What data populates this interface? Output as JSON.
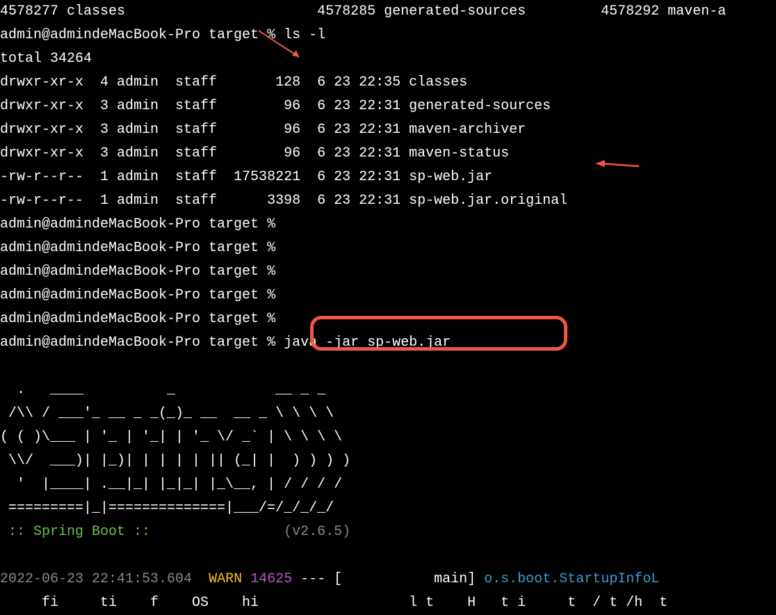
{
  "topcut": "4578277 classes                       4578285 generated-sources         4578292 maven-a",
  "prompt": "admin@admindeMacBook-Pro target %",
  "cmd_ls": "ls -l",
  "total_line": "total 34264",
  "ls_rows": [
    "drwxr-xr-x  4 admin  staff       128  6 23 22:35 classes",
    "drwxr-xr-x  3 admin  staff        96  6 23 22:31 generated-sources",
    "drwxr-xr-x  3 admin  staff        96  6 23 22:31 maven-archiver",
    "drwxr-xr-x  3 admin  staff        96  6 23 22:31 maven-status",
    "-rw-r--r--  1 admin  staff  17538221  6 23 22:31 sp-web.jar",
    "-rw-r--r--  1 admin  staff      3398  6 23 22:31 sp-web.jar.original"
  ],
  "cmd_java": "java -jar sp-web.jar",
  "banner": [
    "  .   ____          _            __ _ _",
    " /\\\\ / ___'_ __ _ _(_)_ __  __ _ \\ \\ \\ \\",
    "( ( )\\___ | '_ | '_| | '_ \\/ _` | \\ \\ \\ \\",
    " \\\\/  ___)| |_)| | | | | || (_| |  ) ) ) )",
    "  '  |____| .__|_| |_|_| |_\\__, | / / / /",
    " =========|_|==============|___/=/_/_/_/"
  ],
  "spring_boot": " :: Spring Boot :: ",
  "spring_version": "(v2.6.5)",
  "log": {
    "timestamp": "2022-06-23 22:41:53.604",
    "level": "WARN",
    "pid": "14625",
    "dashes": " --- [",
    "thread": "           main]",
    "sep": " ",
    "class": "o.s.boot.StartupInfoL"
  },
  "lastcut": "     fi     ti    f    OS    hi                  l t    H   t i     t  / t /h  t                "
}
